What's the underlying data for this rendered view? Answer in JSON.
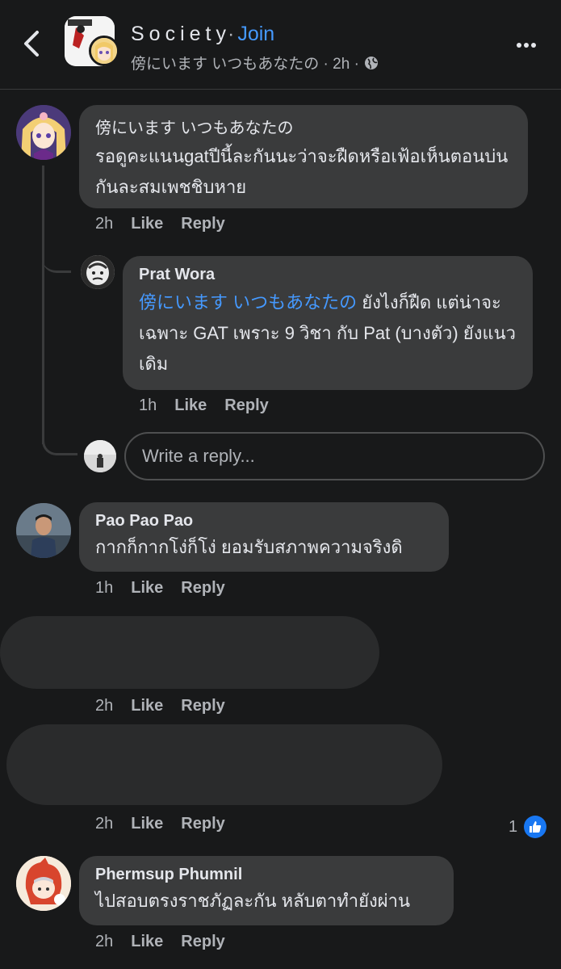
{
  "header": {
    "group_name": "Society",
    "separator": "·",
    "join_label": "Join",
    "subtitle": "傍にいます いつもあなたの · 2h ·"
  },
  "comments": [
    {
      "author": "傍にいます いつもあなたの",
      "text": "รอดูคะแนนgatปีนี้ละกันนะว่าจะฝืดหรือเฟ้อเห็นตอนบ่นกันละสมเพชชิบหาย",
      "time": "2h",
      "like": "Like",
      "reply": "Reply"
    },
    {
      "author": "Prat Wora",
      "mention": "傍にいます いつもあなたの",
      "text": " ยังไงก็ฝืด แต่น่าจะเฉพาะ GAT เพราะ 9 วิชา กับ Pat (บางตัว) ยังแนวเดิม",
      "time": "1h",
      "like": "Like",
      "reply": "Reply"
    },
    {
      "author": "Pao Pao Pao",
      "text": "กากก็กากโง่ก็โง่ ยอมรับสภาพความจริงดิ",
      "time": "1h",
      "like": "Like",
      "reply": "Reply"
    },
    {
      "time": "2h",
      "like": "Like",
      "reply": "Reply"
    },
    {
      "time": "2h",
      "like": "Like",
      "reply": "Reply",
      "reaction_count": "1"
    },
    {
      "author": "Phermsup Phumnil",
      "text": "ไปสอบตรงราชภัฏละกัน หลับตาทำยังผ่าน",
      "time": "2h",
      "like": "Like",
      "reply": "Reply"
    }
  ],
  "reply_box": {
    "placeholder": "Write a reply..."
  },
  "colors": {
    "background": "#18191a",
    "bubble": "#3a3b3c",
    "link": "#4599ff",
    "secondary_text": "#b0b3b8"
  }
}
